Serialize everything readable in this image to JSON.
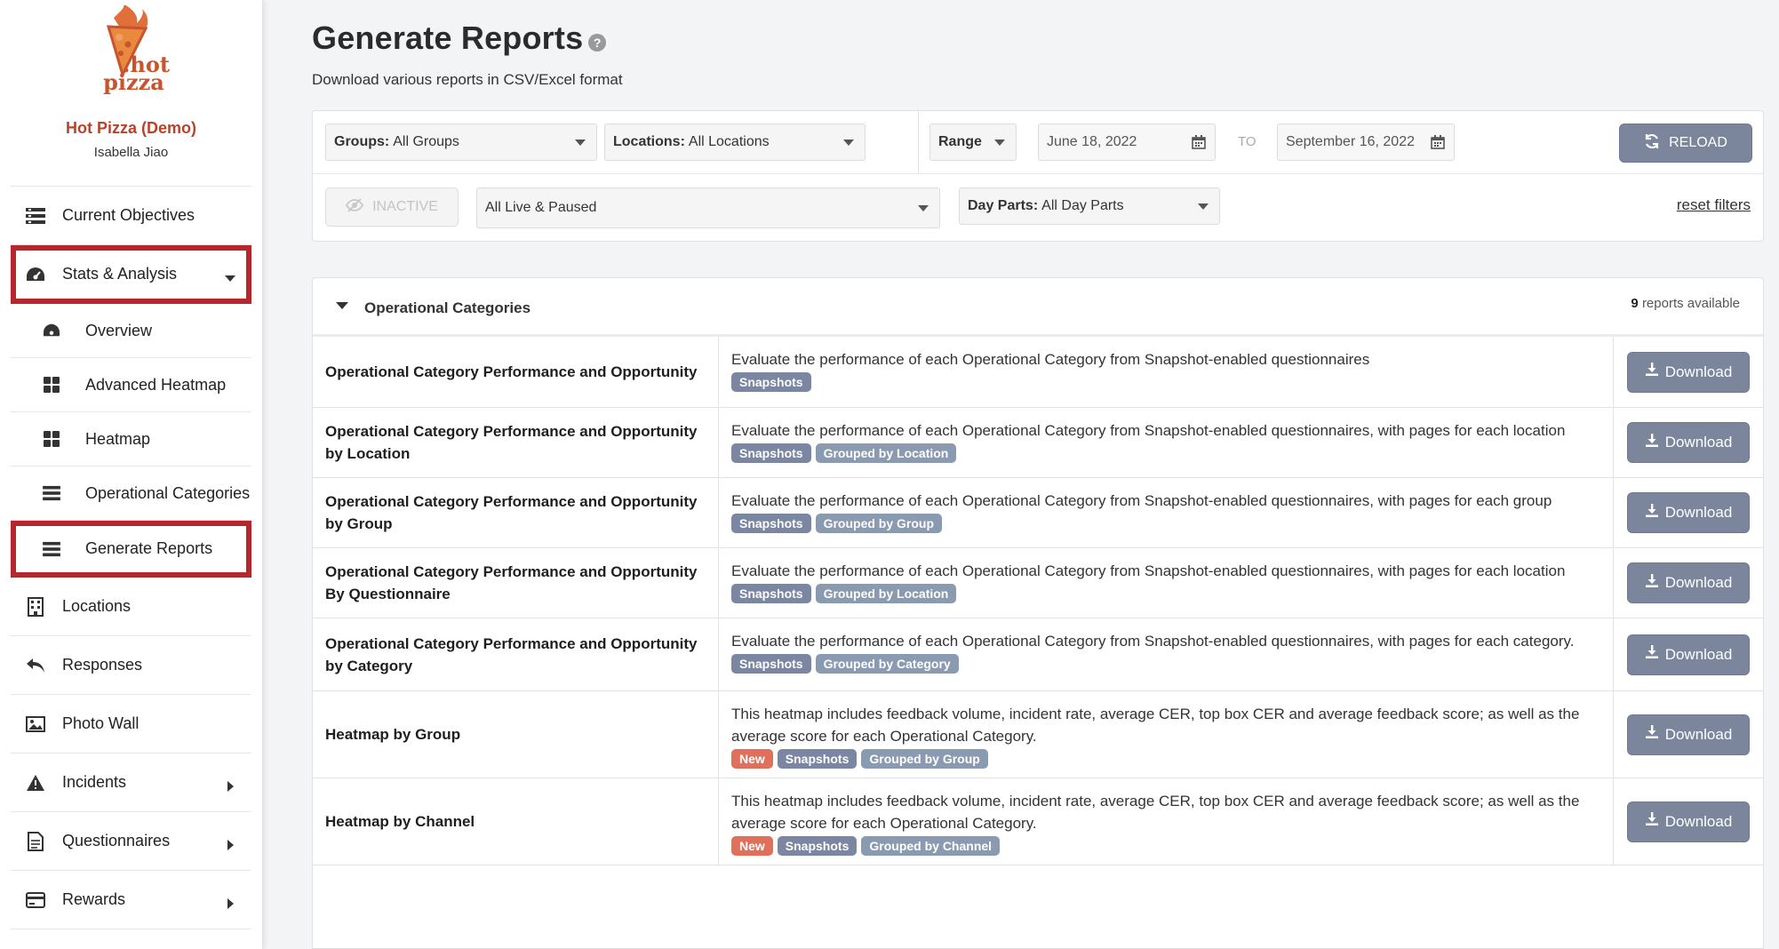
{
  "brand": {
    "logo_top": ".hot",
    "logo_bottom": "pizza",
    "org_name": "Hot Pizza (Demo)",
    "user_name": "Isabella Jiao"
  },
  "nav": {
    "current_objectives": "Current Objectives",
    "stats_analysis": "Stats & Analysis",
    "overview": "Overview",
    "advanced_heatmap": "Advanced Heatmap",
    "heatmap": "Heatmap",
    "operational_categories": "Operational Categories",
    "generate_reports": "Generate Reports",
    "locations": "Locations",
    "responses": "Responses",
    "photo_wall": "Photo Wall",
    "incidents": "Incidents",
    "questionnaires": "Questionnaires",
    "rewards": "Rewards"
  },
  "page": {
    "title": "Generate Reports",
    "subtitle": "Download various reports in CSV/Excel format"
  },
  "filters": {
    "groups_label": "Groups:",
    "groups_value": "All Groups",
    "locations_label": "Locations:",
    "locations_value": "All Locations",
    "range_label": "Range",
    "date_from": "June 18, 2022",
    "to_label": "TO",
    "date_to": "September 16, 2022",
    "reload_label": "RELOAD",
    "inactive_label": "INACTIVE",
    "status_value": "All Live & Paused",
    "dayparts_label": "Day Parts:",
    "dayparts_value": "All Day Parts",
    "reset_label": "reset filters"
  },
  "reports": {
    "section_title": "Operational Categories",
    "count": "9",
    "count_suffix": "reports available",
    "download_label": "Download",
    "rows": [
      {
        "name": "Operational Category Performance and Opportunity",
        "desc": "Evaluate the performance of each Operational Category from Snapshot-enabled questionnaires",
        "tags": [
          "Snapshots"
        ]
      },
      {
        "name": "Operational Category Performance and Opportunity by Location",
        "desc": "Evaluate the performance of each Operational Category from Snapshot-enabled questionnaires, with pages for each location",
        "tags": [
          "Snapshots",
          "Grouped by Location"
        ]
      },
      {
        "name": "Operational Category Performance and Opportunity by Group",
        "desc": "Evaluate the performance of each Operational Category from Snapshot-enabled questionnaires, with pages for each group",
        "tags": [
          "Snapshots",
          "Grouped by Group"
        ]
      },
      {
        "name": "Operational Category Performance and Opportunity By Questionnaire",
        "desc": "Evaluate the performance of each Operational Category from Snapshot-enabled questionnaires, with pages for each location",
        "tags": [
          "Snapshots",
          "Grouped by Location"
        ]
      },
      {
        "name": "Operational Category Performance and Opportunity by Category",
        "desc": "Evaluate the performance of each Operational Category from Snapshot-enabled questionnaires, with pages for each category.",
        "tags": [
          "Snapshots",
          "Grouped by Category"
        ]
      },
      {
        "name": "Heatmap by Group",
        "desc": "This heatmap includes feedback volume, incident rate, average CER, top box CER and average feedback score; as well as the average score for each Operational Category.",
        "tags": [
          "New",
          "Snapshots",
          "Grouped by Group"
        ]
      },
      {
        "name": "Heatmap by Channel",
        "desc": "This heatmap includes feedback volume, incident rate, average CER, top box CER and average feedback score; as well as the average score for each Operational Category.",
        "tags": [
          "New",
          "Snapshots",
          "Grouped by Channel"
        ]
      }
    ]
  },
  "colors": {
    "brand_red": "#b8432a",
    "highlight": "#b5272d",
    "button": "#7b869c",
    "tag_new": "#e0705c"
  }
}
